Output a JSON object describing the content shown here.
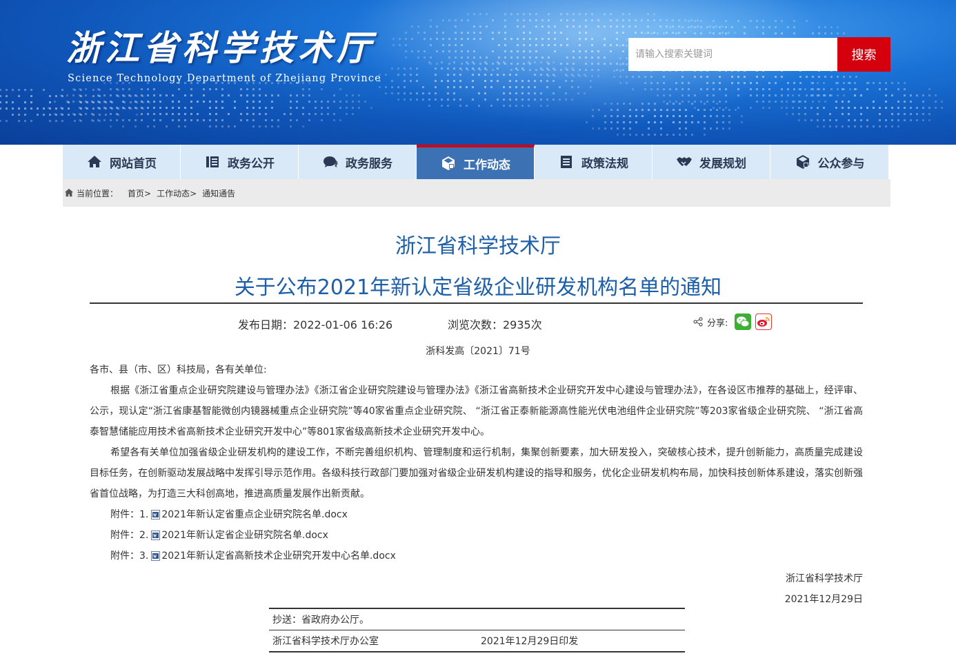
{
  "header": {
    "site_title": "浙江省科学技术厅",
    "site_subtitle": "Science Technology Department of Zhejiang Province",
    "search_placeholder": "请输入搜索关键词",
    "search_button": "搜索"
  },
  "nav": {
    "items": [
      {
        "label": "网站首页",
        "icon": "home-icon"
      },
      {
        "label": "政务公开",
        "icon": "list-icon"
      },
      {
        "label": "政务服务",
        "icon": "chat-icon"
      },
      {
        "label": "工作动态",
        "icon": "news-icon",
        "active": true
      },
      {
        "label": "政策法规",
        "icon": "document-icon"
      },
      {
        "label": "发展规划",
        "icon": "handshake-icon"
      },
      {
        "label": "公众参与",
        "icon": "people-icon"
      }
    ]
  },
  "breadcrumb": {
    "prefix": "当前位置：",
    "items": [
      "首页>",
      "工作动态>",
      "通知通告"
    ]
  },
  "article": {
    "title_line1": "浙江省科学技术厅",
    "title_line2": "关于公布2021年新认定省级企业研发机构名单的通知",
    "publish_date": "发布日期：2022-01-06 16:26",
    "views": "浏览次数：2935次",
    "share_label": "分享:",
    "doc_number": "浙科发高〔2021〕71号",
    "salutation": "各市、县（市、区）科技局，各有关单位:",
    "para1": "根据《浙江省重点企业研究院建设与管理办法》《浙江省企业研究院建设与管理办法》《浙江省高新技术企业研究开发中心建设与管理办法》，在各设区市推荐的基础上，经评审、公示，现认定“浙江省康基智能微创内镜器械重点企业研究院”等40家省重点企业研究院、 “浙江省正泰新能源高性能光伏电池组件企业研究院”等203家省级企业研究院、 “浙江省高泰智慧储能应用技术省高新技术企业研究开发中心”等801家省级高新技术企业研究开发中心。",
    "para2": "希望各有关单位加强省级企业研发机构的建设工作，不断完善组织机构、管理制度和运行机制，集聚创新要素，加大研发投入，突破核心技术，提升创新能力，高质量完成建设目标任务，在创新驱动发展战略中发挥引导示范作用。各级科技行政部门要加强对省级企业研发机构建设的指导和服务，优化企业研发机构布局，加快科技创新体系建设，落实创新强省首位战略，为打造三大科创高地，推进高质量发展作出新贡献。",
    "attachments": [
      {
        "prefix": "附件：1.",
        "name": "2021年新认定省重点企业研究院名单.docx"
      },
      {
        "prefix": "附件：2.",
        "name": "2021年新认定省企业研究院名单.docx"
      },
      {
        "prefix": "附件：3.",
        "name": "2021年新认定省高新技术企业研究开发中心名单.docx"
      }
    ],
    "signature_org": "浙江省科学技术厅",
    "signature_date": "2021年12月29日",
    "cc_line": "抄送：省政府办公厅。",
    "issuer": "浙江省科学技术厅办公室",
    "issue_date": "2021年12月29日印发"
  }
}
